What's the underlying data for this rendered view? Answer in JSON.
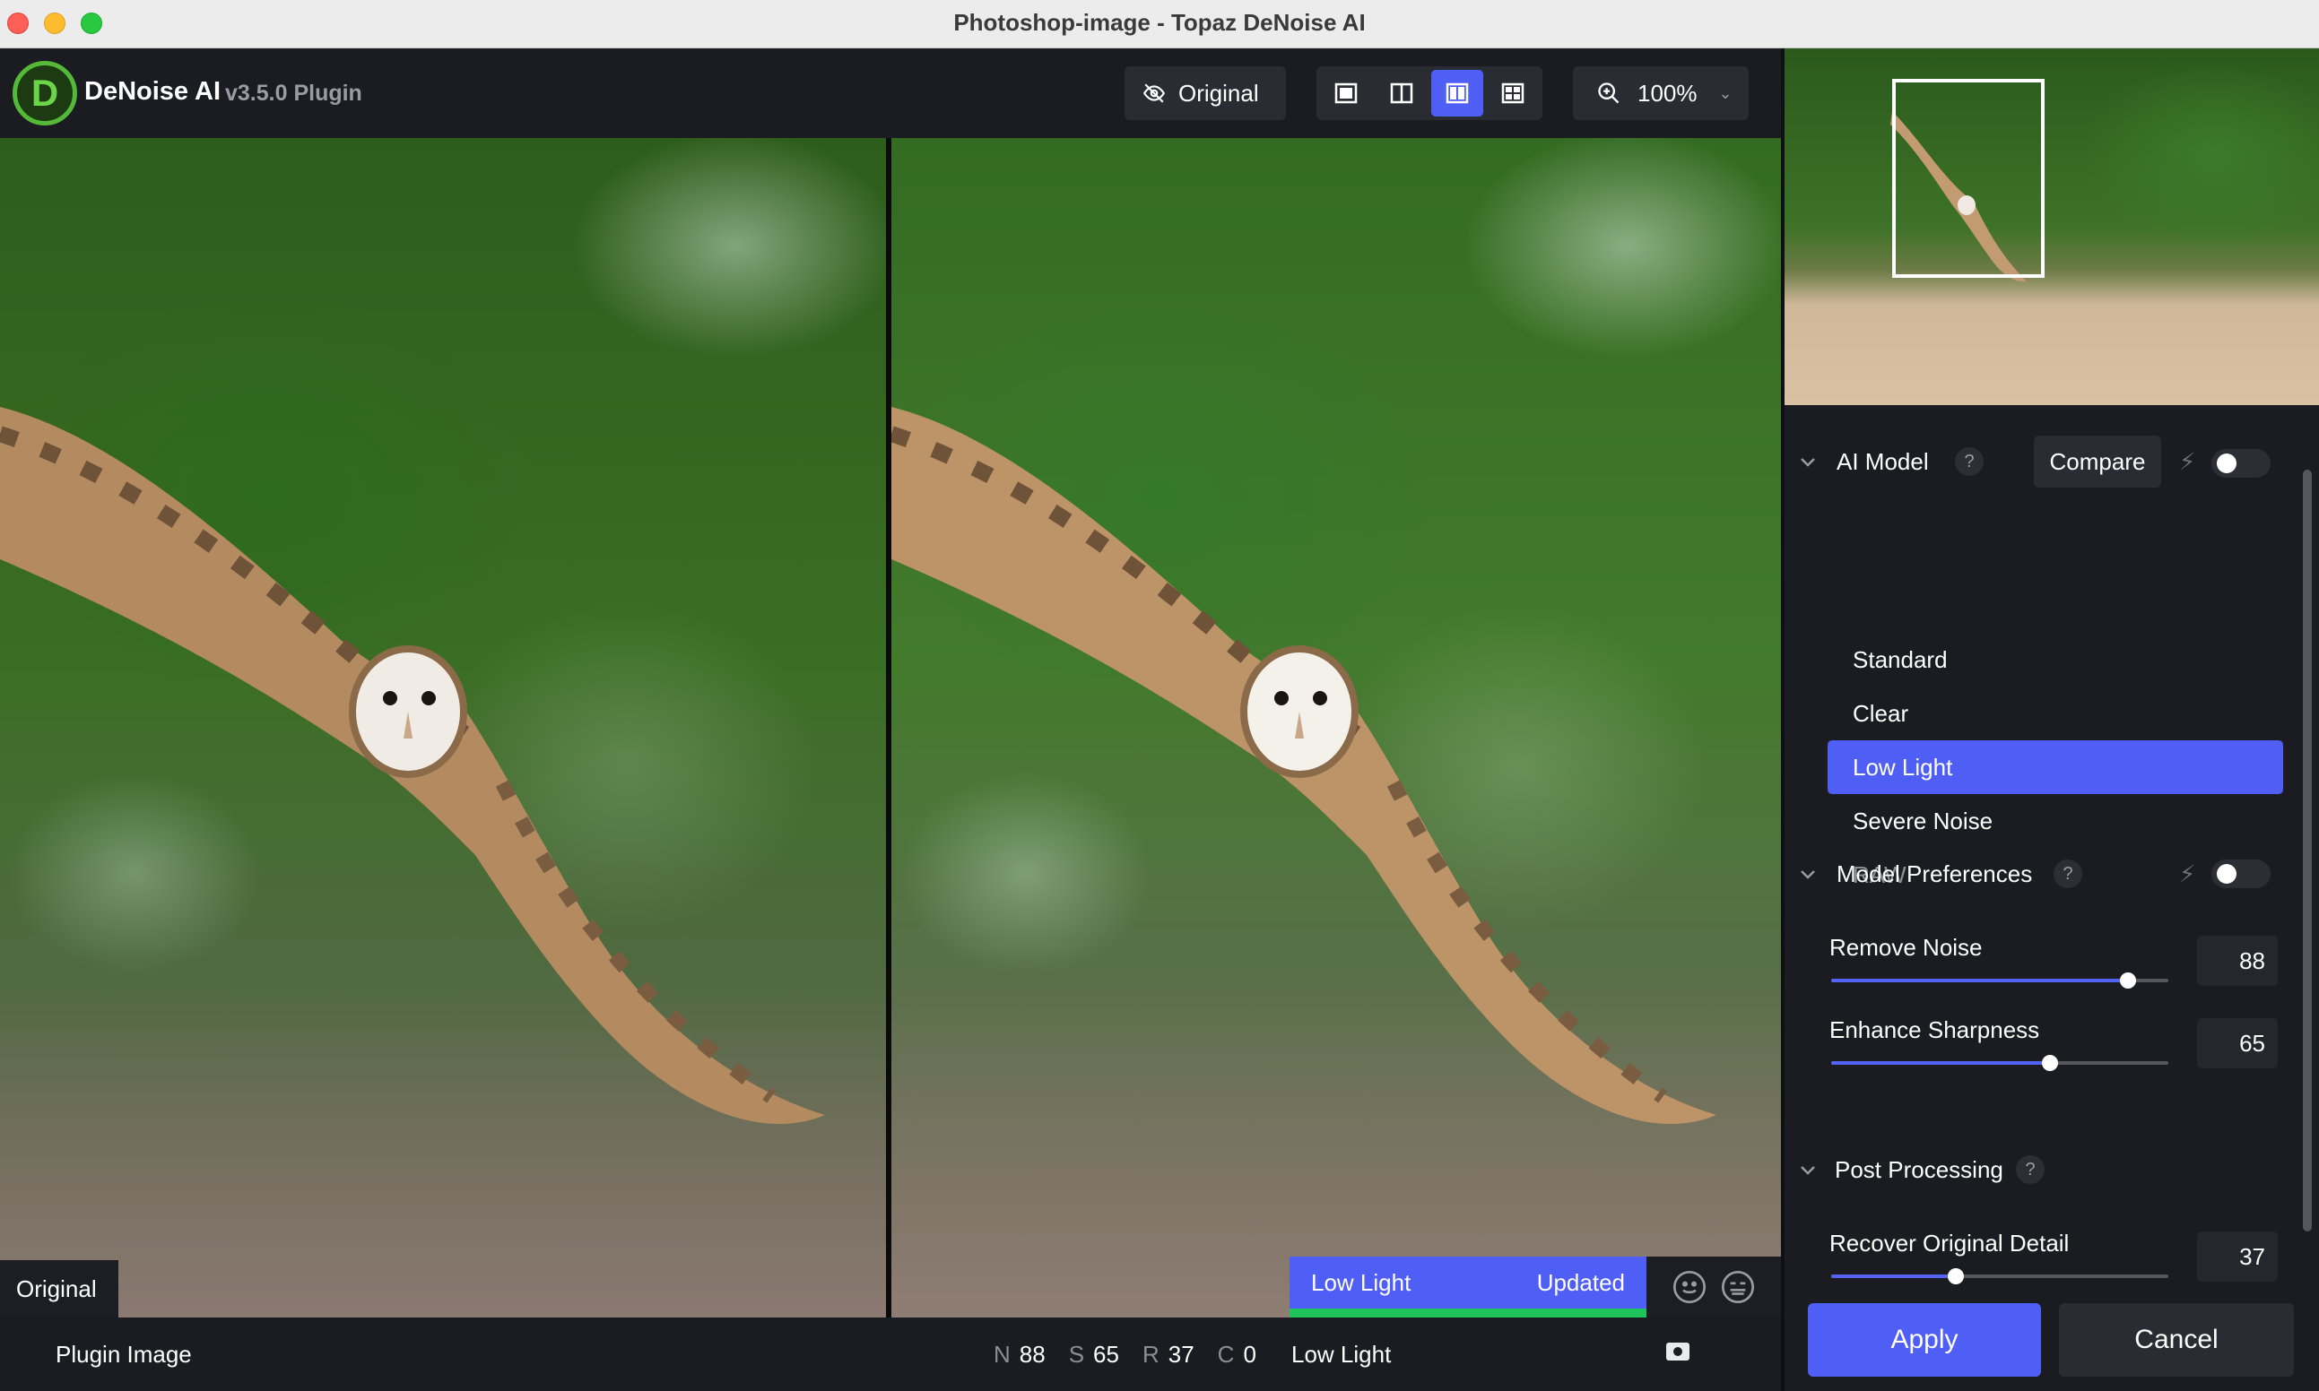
{
  "window": {
    "title": "Photoshop-image - Topaz DeNoise AI"
  },
  "app": {
    "logo_letter": "D",
    "name": "DeNoise AI",
    "version": "v3.5.0 Plugin"
  },
  "toolbar": {
    "original_label": "Original",
    "view_modes": [
      "single-view",
      "split-view",
      "side-by-side-view",
      "quad-view"
    ],
    "active_view": "side-by-side-view",
    "zoom": "100%"
  },
  "viewer": {
    "left_label": "Original",
    "status_model": "Low Light",
    "status_state": "Updated"
  },
  "statusbar": {
    "source": "Plugin Image",
    "params": [
      {
        "key": "N",
        "value": "88"
      },
      {
        "key": "S",
        "value": "65"
      },
      {
        "key": "R",
        "value": "37"
      },
      {
        "key": "C",
        "value": "0"
      }
    ],
    "model": "Low Light"
  },
  "sidebar": {
    "ai_model": {
      "title": "AI Model",
      "help": "?",
      "compare_label": "Compare",
      "models": [
        {
          "label": "Standard",
          "state": "normal"
        },
        {
          "label": "Clear",
          "state": "normal"
        },
        {
          "label": "Low Light",
          "state": "active"
        },
        {
          "label": "Severe Noise",
          "state": "normal"
        },
        {
          "label": "RAW",
          "state": "disabled"
        }
      ]
    },
    "model_prefs": {
      "title": "Model Preferences",
      "help": "?",
      "remove_noise": {
        "label": "Remove Noise",
        "value": "88",
        "fraction": 0.88
      },
      "enhance_sharpness": {
        "label": "Enhance Sharpness",
        "value": "65",
        "fraction": 0.65
      }
    },
    "post_processing": {
      "title": "Post Processing",
      "help": "?",
      "recover_detail": {
        "label": "Recover Original Detail",
        "value": "37",
        "fraction": 0.37
      }
    }
  },
  "actions": {
    "apply": "Apply",
    "cancel": "Cancel"
  },
  "colors": {
    "accent": "#4f5ef5",
    "updated_bar": "#1fc35b",
    "logo_green": "#54b838"
  }
}
